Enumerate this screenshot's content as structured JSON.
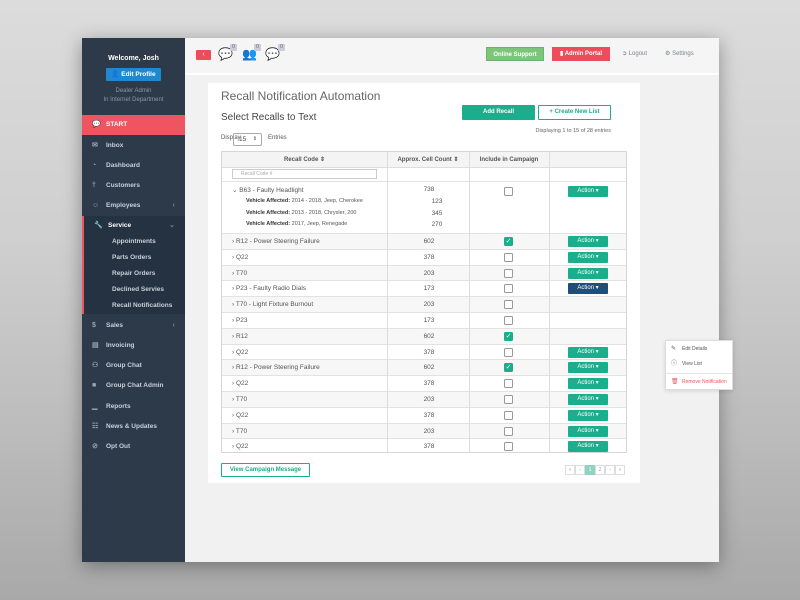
{
  "sidebar": {
    "welcome": "Welcome, Josh",
    "edit_profile": "Edit Profile",
    "role": "Dealer Admin",
    "department": "In Internet Department",
    "items": [
      {
        "label": "START",
        "icon": "chat-icon"
      },
      {
        "label": "Inbox",
        "icon": "inbox-icon"
      },
      {
        "label": "Dashboard",
        "icon": "dashboard-icon"
      },
      {
        "label": "Customers",
        "icon": "customer-icon"
      },
      {
        "label": "Employees",
        "icon": "user-icon"
      },
      {
        "label": "Service",
        "icon": "wrench-icon"
      },
      {
        "label": "Sales",
        "icon": "dollar-icon"
      },
      {
        "label": "Invoicing",
        "icon": "invoice-icon"
      },
      {
        "label": "Group Chat",
        "icon": "group-icon"
      },
      {
        "label": "Group Chat Admin",
        "icon": "briefcase-icon"
      },
      {
        "label": "Reports",
        "icon": "chart-icon"
      },
      {
        "label": "News & Updates",
        "icon": "news-icon"
      },
      {
        "label": "Opt Out",
        "icon": "block-icon"
      }
    ],
    "service_sub": [
      "Appointments",
      "Parts Orders",
      "Repair Orders",
      "Declined Servies",
      "Recall Notifications"
    ]
  },
  "topbar": {
    "badges": [
      "0",
      "0",
      "0"
    ],
    "online_support": "Online Support",
    "admin_portal": "Admin Portal",
    "logout": "Logout",
    "settings": "Settings"
  },
  "page": {
    "title": "Recall Notification Automation",
    "subtitle": "Select Recalls to Text",
    "add_recall": "Add Recall",
    "create_list": "+ Create New List",
    "displaying": "Displaying 1 to 15 of 28 entries",
    "display_label": "Display",
    "display_value": "15",
    "entries_label": "Entries",
    "view_campaign": "View Campaign Message"
  },
  "table": {
    "headers": [
      "Recall Code",
      "Approx. Cell Count",
      "Include in Campaign"
    ],
    "filter_placeholder": "Recall Code #",
    "expanded": {
      "code": "B63 - Faulty Headlight",
      "count": "738",
      "checked": false,
      "action": "Action",
      "vehicles": [
        {
          "label": "Vehicle Affected:",
          "value": "2014 - 2018, Jeep, Cherokee",
          "count": "123"
        },
        {
          "label": "Vehicle Affected:",
          "value": "2013 - 2018, Chrysler, 200",
          "count": "345"
        },
        {
          "label": "Vehicle Affected:",
          "value": "2017, Jeep, Renegade",
          "count": "270"
        }
      ]
    },
    "rows": [
      {
        "code": "R12 - Power Steering Failure",
        "count": "602",
        "checked": true
      },
      {
        "code": "Q22",
        "count": "378",
        "checked": false
      },
      {
        "code": "T70",
        "count": "203",
        "checked": false
      },
      {
        "code": "P23 - Faulty Radio Dials",
        "count": "173",
        "checked": false,
        "active": true
      },
      {
        "code": "T70 - Light Fixture Burnout",
        "count": "203",
        "checked": false
      },
      {
        "code": "P23",
        "count": "173",
        "checked": false
      },
      {
        "code": "R12",
        "count": "602",
        "checked": true
      },
      {
        "code": "Q22",
        "count": "378",
        "checked": false
      },
      {
        "code": "R12 - Power Steering Failure",
        "count": "602",
        "checked": true
      },
      {
        "code": "Q22",
        "count": "378",
        "checked": false
      },
      {
        "code": "T70",
        "count": "203",
        "checked": false
      },
      {
        "code": "Q22",
        "count": "378",
        "checked": false
      },
      {
        "code": "T70",
        "count": "203",
        "checked": false
      },
      {
        "code": "Q22",
        "count": "378",
        "checked": false
      }
    ],
    "action_label": "Action"
  },
  "action_menu": {
    "edit": "Edit Details",
    "view": "View List",
    "remove": "Remove Notification"
  },
  "pagination": {
    "first": "«",
    "prev": "‹",
    "pages": [
      "1",
      "2"
    ],
    "current": "1",
    "next": "›",
    "last": "»"
  },
  "colors": {
    "accent": "#1bae8c",
    "danger": "#ee4c5a",
    "sidebar": "#2c3a4a",
    "active_action": "#1f4f79"
  }
}
